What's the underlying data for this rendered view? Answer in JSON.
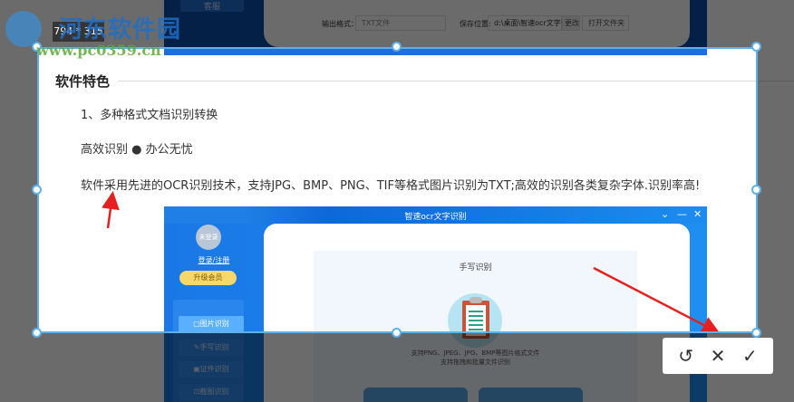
{
  "top_app": {
    "service_label": "客服",
    "output_format_label": "输出格式：",
    "output_format_value": "TXT文件",
    "save_location_label": "保存位置:",
    "save_location_value": "d:\\桌面\\智速ocr文字识别",
    "change_button": "更改",
    "open_folder_button": "打开文件夹"
  },
  "article": {
    "heading": "软件特色",
    "item1": "1、多种格式文档识别转换",
    "tagline": "高效识别 ● 办公无忧",
    "description": "软件采用先进的OCR识别技术，支持JPG、BMP、PNG、TIF等格式图片识别为TXT;高效的识别各类复杂字体.识别率高!"
  },
  "app_window": {
    "title": "智速ocr文字识别",
    "avatar_text": "未登录",
    "login_link": "登录/注册",
    "vip_button": "升级会员",
    "menu": [
      "▢图片识别",
      "✎手写识别",
      "▣证件识别",
      "⊡截图识别"
    ],
    "panel_title": "手写识别",
    "support_line1": "支持PNG、JPEG、JPG、BMP等图片格式文件",
    "support_line2": "支持拖拽和批量文件识别"
  },
  "capture": {
    "size_label": "794 * 315",
    "toolbar": {
      "undo": "↺",
      "cancel": "✕",
      "confirm": "✓"
    }
  },
  "watermark": {
    "name": "河东软件园",
    "url": "www.pc0359.cn"
  },
  "colors": {
    "selection_border": "#5fb0e6",
    "arrow": "#e52020",
    "app_blue": "#1a78e6"
  }
}
